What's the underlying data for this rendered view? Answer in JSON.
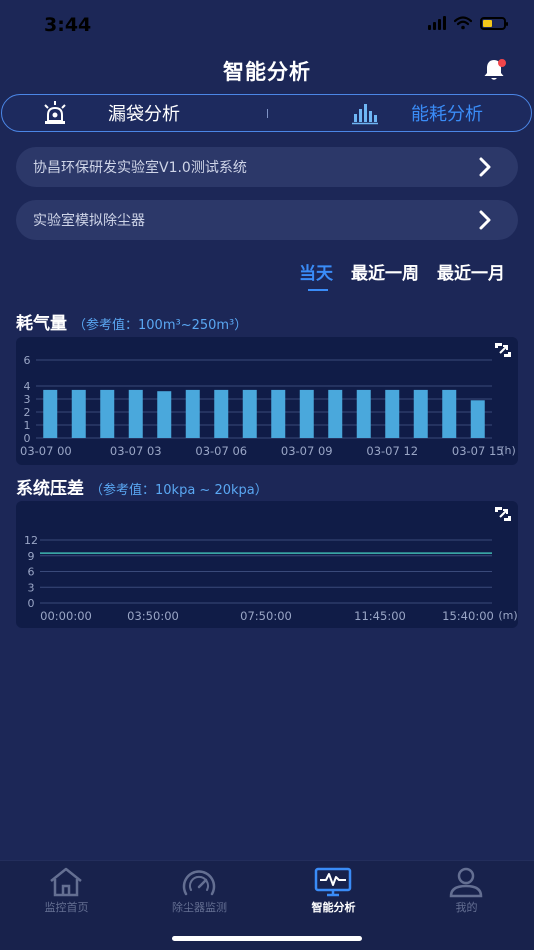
{
  "status_bar": {
    "time": "3:44"
  },
  "header": {
    "title": "智能分析"
  },
  "segment_tabs": [
    {
      "label": "漏袋分析",
      "icon": "alarm-light-icon"
    },
    {
      "label": "能耗分析",
      "icon": "energy-chart-icon"
    }
  ],
  "selectors": {
    "system": "协昌环保研发实验室V1.0测试系统",
    "device": "实验室模拟除尘器"
  },
  "range_tabs": [
    {
      "label": "当天",
      "active": true
    },
    {
      "label": "最近一周",
      "active": false
    },
    {
      "label": "最近一月",
      "active": false
    }
  ],
  "sections": {
    "gas": {
      "title": "耗气量",
      "reference": "（参考值：100m³~250m³）"
    },
    "pressure": {
      "title": "系统压差",
      "reference": "（参考值：10kpa ~ 20kpa）"
    }
  },
  "colors": {
    "background": "#1c2757",
    "accent": "#3a8cf7",
    "bar": "#4aa8dc",
    "line": "#3fb7b1",
    "card": "#101c47"
  },
  "chart_data": [
    {
      "type": "bar",
      "categories": [
        "03-07 00",
        "03-07 01",
        "03-07 02",
        "03-07 03",
        "03-07 04",
        "03-07 05",
        "03-07 06",
        "03-07 07",
        "03-07 08",
        "03-07 09",
        "03-07 10",
        "03-07 11",
        "03-07 12",
        "03-07 13",
        "03-07 14",
        "03-07 15"
      ],
      "x_tick_labels": [
        "03-07 00",
        "03-07 03",
        "03-07 06",
        "03-07 09",
        "03-07 12",
        "03-07 15"
      ],
      "x_unit": "(h)",
      "values": [
        3.7,
        3.7,
        3.7,
        3.7,
        3.6,
        3.7,
        3.7,
        3.7,
        3.7,
        3.7,
        3.7,
        3.7,
        3.7,
        3.7,
        3.7,
        2.9
      ],
      "ylim": [
        0,
        6
      ],
      "yticks": [
        0,
        1,
        2,
        3,
        4,
        6
      ],
      "grid": true
    },
    {
      "type": "line",
      "x_tick_labels": [
        "00:00:00",
        "03:50:00",
        "07:50:00",
        "11:45:00",
        "15:40:00"
      ],
      "x_unit": "(m)",
      "series": [
        {
          "values": [
            9.5,
            9.5,
            9.5,
            9.5,
            9.5,
            9.5,
            9.5,
            9.5,
            9.5,
            9.5
          ]
        }
      ],
      "ylim": [
        0,
        12
      ],
      "yticks": [
        0,
        3,
        6,
        9,
        12
      ],
      "grid": true
    }
  ],
  "tab_bar": [
    {
      "label": "监控首页",
      "icon": "home-icon",
      "active": false
    },
    {
      "label": "除尘器监测",
      "icon": "gauge-icon",
      "active": false
    },
    {
      "label": "智能分析",
      "icon": "monitor-pulse-icon",
      "active": true
    },
    {
      "label": "我的",
      "icon": "user-icon",
      "active": false
    }
  ]
}
